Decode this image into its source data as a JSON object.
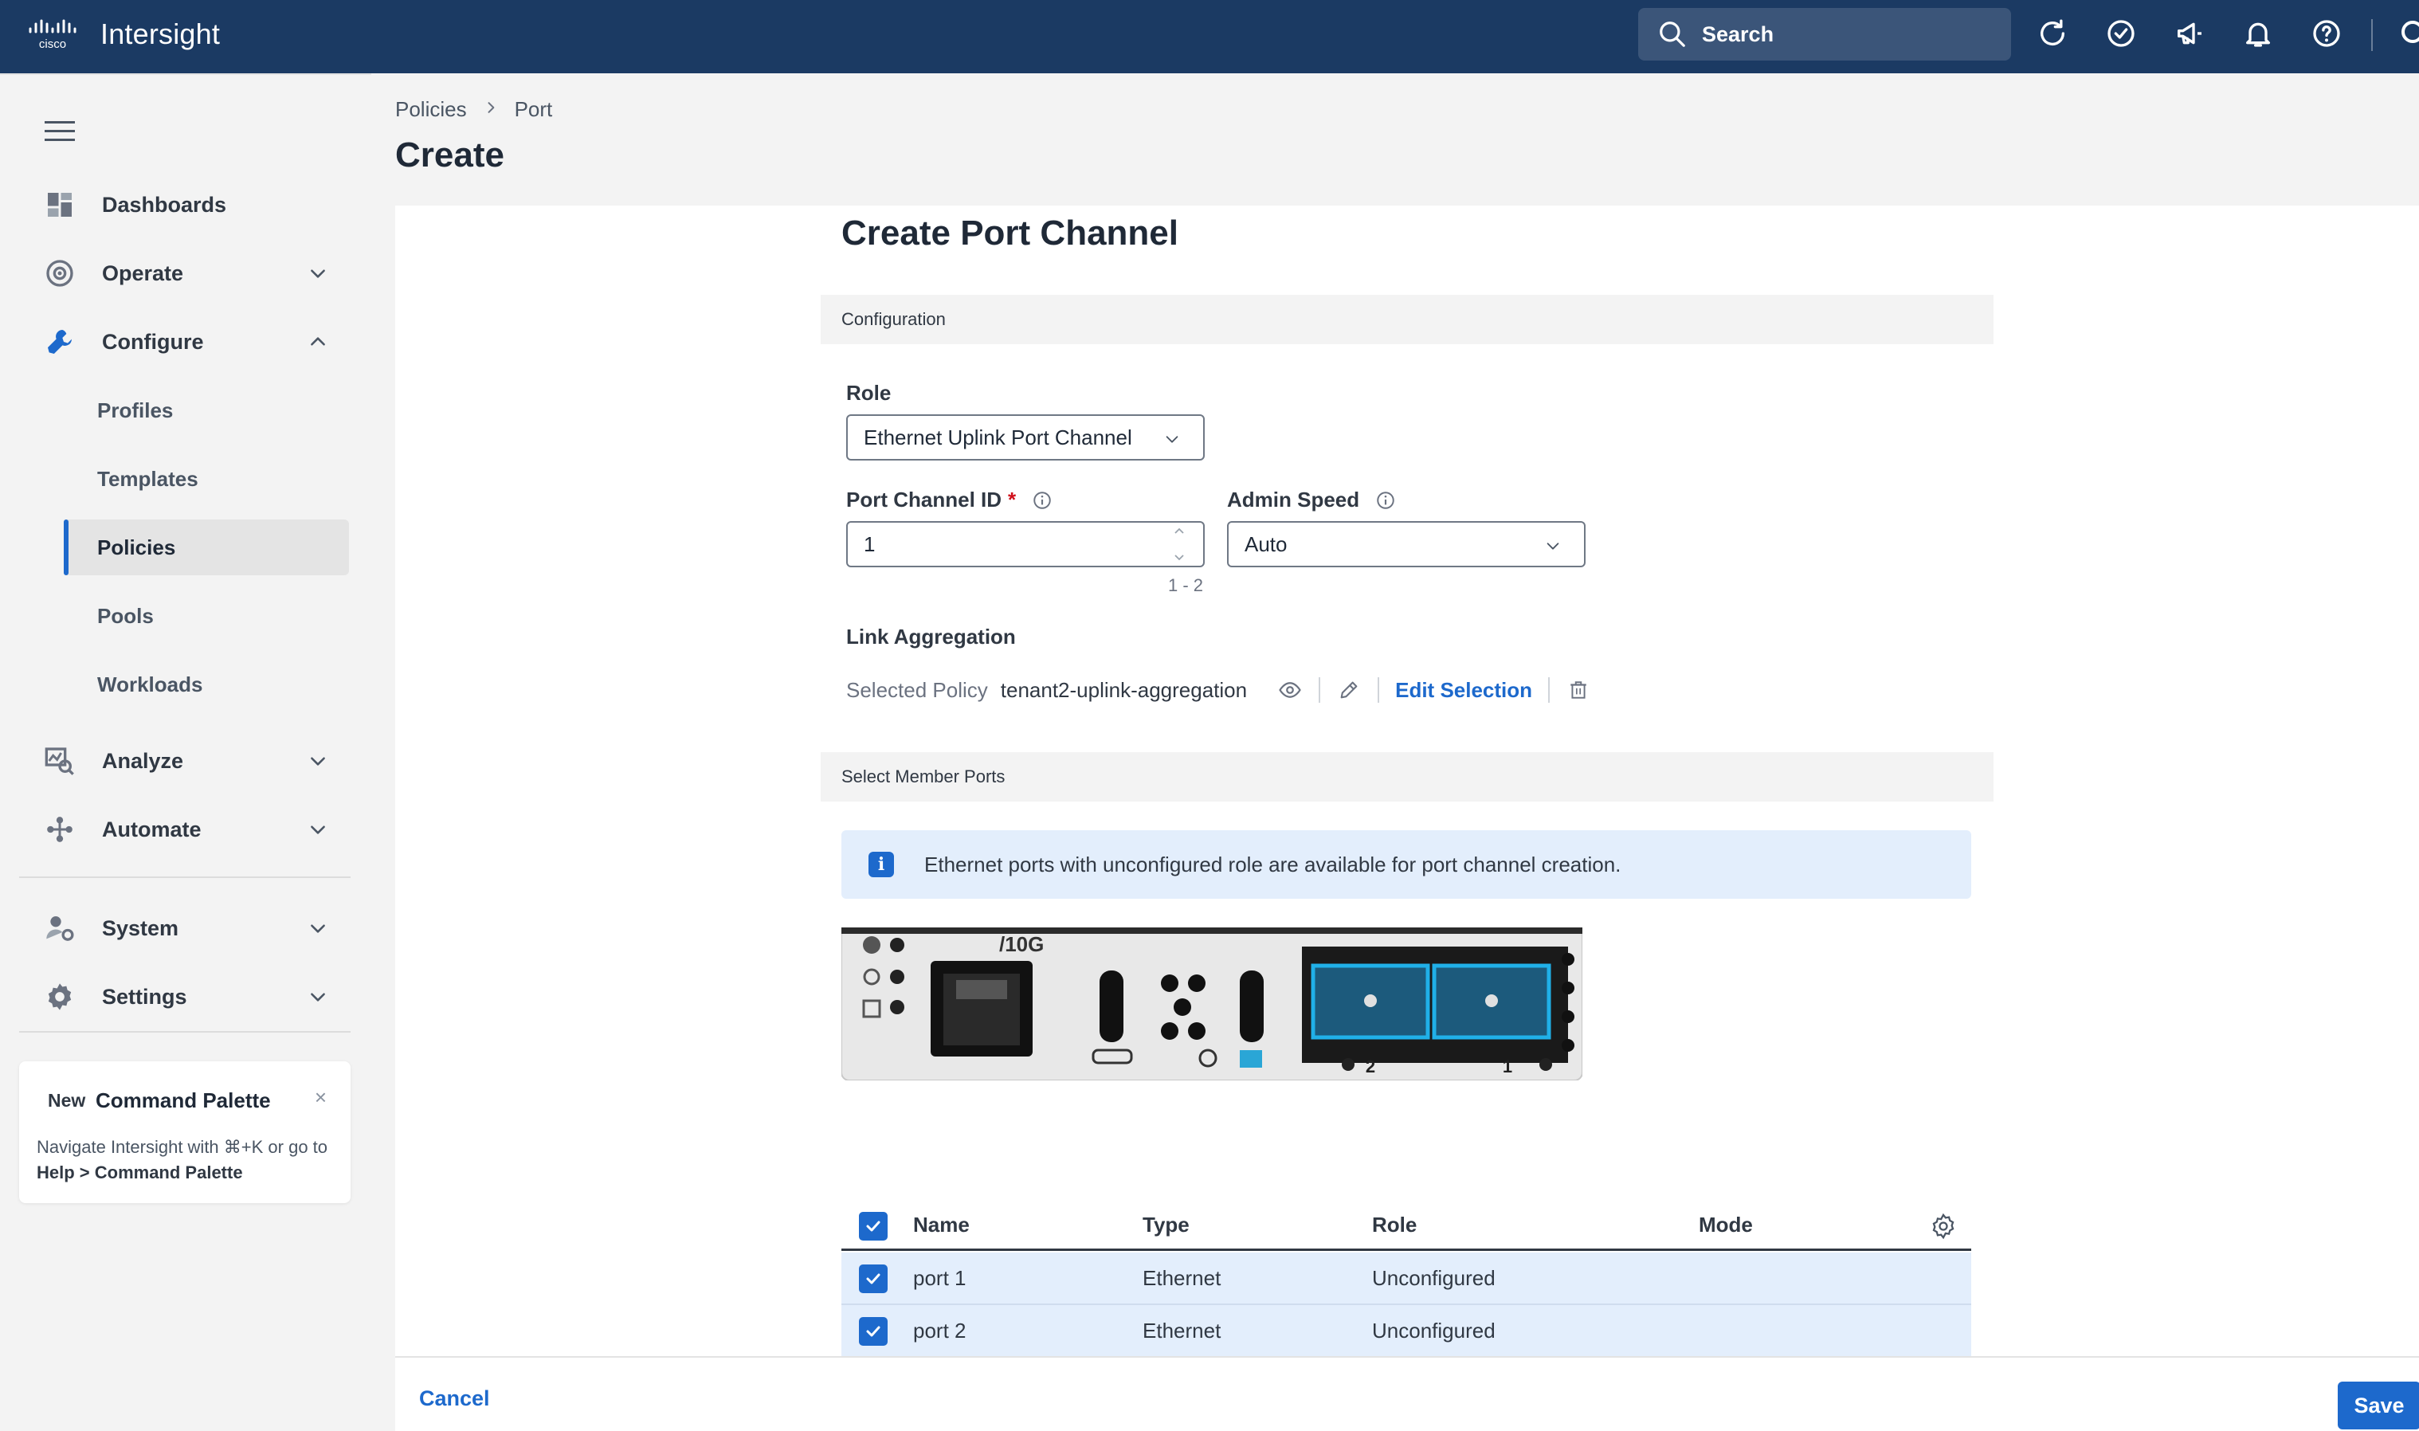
{
  "app": {
    "brand": "Intersight",
    "logo_text": "cisco"
  },
  "topbar": {
    "search_placeholder": "Search",
    "icons": [
      "refresh-icon",
      "check-circle-icon",
      "megaphone-icon",
      "bell-icon",
      "help-icon",
      "user-icon"
    ]
  },
  "sidebar": {
    "items": [
      {
        "label": "Dashboards",
        "icon": "dashboard-icon"
      },
      {
        "label": "Operate",
        "icon": "operate-icon"
      },
      {
        "label": "Configure",
        "icon": "wrench-icon"
      },
      {
        "label": "Analyze",
        "icon": "analyze-icon"
      },
      {
        "label": "Automate",
        "icon": "automate-icon"
      },
      {
        "label": "System",
        "icon": "system-icon"
      },
      {
        "label": "Settings",
        "icon": "gear-icon"
      }
    ],
    "configure_sub": [
      "Profiles",
      "Templates",
      "Policies",
      "Pools",
      "Workloads"
    ],
    "active_sub": "Policies",
    "command_palette": {
      "tag": "New",
      "title": "Command Palette",
      "close": "×",
      "text_prefix": "Navigate Intersight with ⌘+K or go to ",
      "text_link": "Help > Command Palette"
    }
  },
  "header": {
    "breadcrumb": [
      "Policies",
      "Port"
    ],
    "title": "Create"
  },
  "form": {
    "title": "Create Port Channel",
    "config_section": "Configuration",
    "role_label": "Role",
    "role_value": "Ethernet Uplink Port Channel",
    "port_channel_id_label": "Port Channel ID",
    "required_marker": "*",
    "port_channel_id_value": "1",
    "port_channel_id_range": "1 - 2",
    "admin_speed_label": "Admin Speed",
    "admin_speed_value": "Auto",
    "link_aggregation_label": "Link Aggregation",
    "selected_policy_label": "Selected Policy",
    "selected_policy_value": "tenant2-uplink-aggregation",
    "edit_selection": "Edit Selection",
    "member_ports_section": "Select Member Ports",
    "info_banner": "Ethernet ports with unconfigured role are available for port channel creation.",
    "port_image": {
      "speed_label": "/10G",
      "port_numbers": [
        "2",
        "1"
      ]
    }
  },
  "table": {
    "columns": [
      "Name",
      "Type",
      "Role",
      "Mode"
    ],
    "rows": [
      {
        "name": "port 1",
        "type": "Ethernet",
        "role": "Unconfigured",
        "mode": "",
        "checked": true
      },
      {
        "name": "port 2",
        "type": "Ethernet",
        "role": "Unconfigured",
        "mode": "",
        "checked": true
      }
    ]
  },
  "footer": {
    "cancel": "Cancel",
    "save": "Save"
  },
  "colors": {
    "topbar": "#1b3a63",
    "accent": "#1d69cc",
    "selected_row": "#e3eefc",
    "required": "#d0101b"
  }
}
